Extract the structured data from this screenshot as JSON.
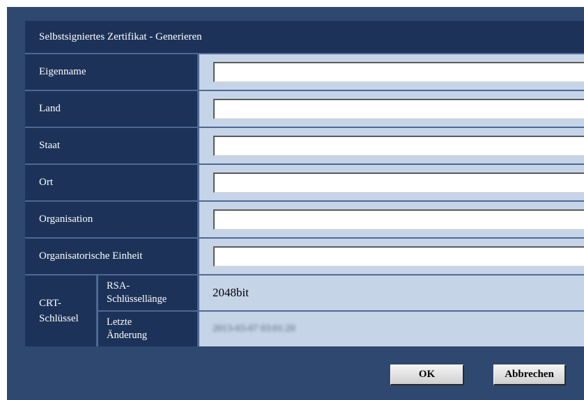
{
  "dialog": {
    "title": "Selbstsigniertes Zertifikat - Generieren"
  },
  "fields": [
    {
      "label": "Eigenname",
      "value": ""
    },
    {
      "label": "Land",
      "value": ""
    },
    {
      "label": "Staat",
      "value": ""
    },
    {
      "label": "Ort",
      "value": ""
    },
    {
      "label": "Organisation",
      "value": ""
    },
    {
      "label": "Organisatorische Einheit",
      "value": ""
    }
  ],
  "crt": {
    "label_line1": "CRT-",
    "label_line2": "Schlüssel",
    "key_length_label_line1": "RSA-",
    "key_length_label_line2": "Schlüssellänge",
    "key_length_value": "2048bit",
    "last_change_label_line1": "Letzte",
    "last_change_label_line2": "Änderung",
    "last_change_value": "2013-03-07 03:01:20"
  },
  "buttons": {
    "ok": "OK",
    "cancel": "Abbrechen"
  },
  "colors": {
    "dialog_background": "#2f4870",
    "label_background": "#1c3258",
    "field_background": "#c6d4e8"
  }
}
